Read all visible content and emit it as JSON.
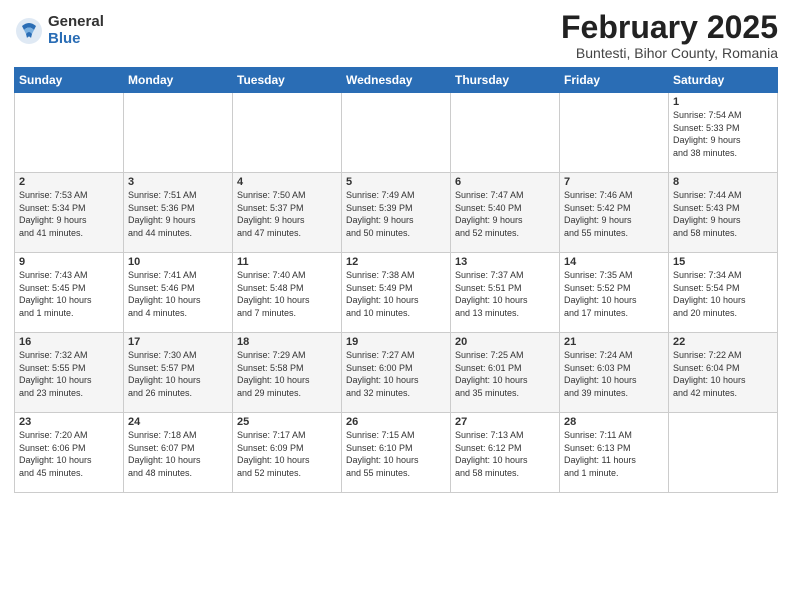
{
  "header": {
    "logo_general": "General",
    "logo_blue": "Blue",
    "month_title": "February 2025",
    "location": "Buntesti, Bihor County, Romania"
  },
  "weekdays": [
    "Sunday",
    "Monday",
    "Tuesday",
    "Wednesday",
    "Thursday",
    "Friday",
    "Saturday"
  ],
  "weeks": [
    [
      {
        "day": "",
        "info": ""
      },
      {
        "day": "",
        "info": ""
      },
      {
        "day": "",
        "info": ""
      },
      {
        "day": "",
        "info": ""
      },
      {
        "day": "",
        "info": ""
      },
      {
        "day": "",
        "info": ""
      },
      {
        "day": "1",
        "info": "Sunrise: 7:54 AM\nSunset: 5:33 PM\nDaylight: 9 hours\nand 38 minutes."
      }
    ],
    [
      {
        "day": "2",
        "info": "Sunrise: 7:53 AM\nSunset: 5:34 PM\nDaylight: 9 hours\nand 41 minutes."
      },
      {
        "day": "3",
        "info": "Sunrise: 7:51 AM\nSunset: 5:36 PM\nDaylight: 9 hours\nand 44 minutes."
      },
      {
        "day": "4",
        "info": "Sunrise: 7:50 AM\nSunset: 5:37 PM\nDaylight: 9 hours\nand 47 minutes."
      },
      {
        "day": "5",
        "info": "Sunrise: 7:49 AM\nSunset: 5:39 PM\nDaylight: 9 hours\nand 50 minutes."
      },
      {
        "day": "6",
        "info": "Sunrise: 7:47 AM\nSunset: 5:40 PM\nDaylight: 9 hours\nand 52 minutes."
      },
      {
        "day": "7",
        "info": "Sunrise: 7:46 AM\nSunset: 5:42 PM\nDaylight: 9 hours\nand 55 minutes."
      },
      {
        "day": "8",
        "info": "Sunrise: 7:44 AM\nSunset: 5:43 PM\nDaylight: 9 hours\nand 58 minutes."
      }
    ],
    [
      {
        "day": "9",
        "info": "Sunrise: 7:43 AM\nSunset: 5:45 PM\nDaylight: 10 hours\nand 1 minute."
      },
      {
        "day": "10",
        "info": "Sunrise: 7:41 AM\nSunset: 5:46 PM\nDaylight: 10 hours\nand 4 minutes."
      },
      {
        "day": "11",
        "info": "Sunrise: 7:40 AM\nSunset: 5:48 PM\nDaylight: 10 hours\nand 7 minutes."
      },
      {
        "day": "12",
        "info": "Sunrise: 7:38 AM\nSunset: 5:49 PM\nDaylight: 10 hours\nand 10 minutes."
      },
      {
        "day": "13",
        "info": "Sunrise: 7:37 AM\nSunset: 5:51 PM\nDaylight: 10 hours\nand 13 minutes."
      },
      {
        "day": "14",
        "info": "Sunrise: 7:35 AM\nSunset: 5:52 PM\nDaylight: 10 hours\nand 17 minutes."
      },
      {
        "day": "15",
        "info": "Sunrise: 7:34 AM\nSunset: 5:54 PM\nDaylight: 10 hours\nand 20 minutes."
      }
    ],
    [
      {
        "day": "16",
        "info": "Sunrise: 7:32 AM\nSunset: 5:55 PM\nDaylight: 10 hours\nand 23 minutes."
      },
      {
        "day": "17",
        "info": "Sunrise: 7:30 AM\nSunset: 5:57 PM\nDaylight: 10 hours\nand 26 minutes."
      },
      {
        "day": "18",
        "info": "Sunrise: 7:29 AM\nSunset: 5:58 PM\nDaylight: 10 hours\nand 29 minutes."
      },
      {
        "day": "19",
        "info": "Sunrise: 7:27 AM\nSunset: 6:00 PM\nDaylight: 10 hours\nand 32 minutes."
      },
      {
        "day": "20",
        "info": "Sunrise: 7:25 AM\nSunset: 6:01 PM\nDaylight: 10 hours\nand 35 minutes."
      },
      {
        "day": "21",
        "info": "Sunrise: 7:24 AM\nSunset: 6:03 PM\nDaylight: 10 hours\nand 39 minutes."
      },
      {
        "day": "22",
        "info": "Sunrise: 7:22 AM\nSunset: 6:04 PM\nDaylight: 10 hours\nand 42 minutes."
      }
    ],
    [
      {
        "day": "23",
        "info": "Sunrise: 7:20 AM\nSunset: 6:06 PM\nDaylight: 10 hours\nand 45 minutes."
      },
      {
        "day": "24",
        "info": "Sunrise: 7:18 AM\nSunset: 6:07 PM\nDaylight: 10 hours\nand 48 minutes."
      },
      {
        "day": "25",
        "info": "Sunrise: 7:17 AM\nSunset: 6:09 PM\nDaylight: 10 hours\nand 52 minutes."
      },
      {
        "day": "26",
        "info": "Sunrise: 7:15 AM\nSunset: 6:10 PM\nDaylight: 10 hours\nand 55 minutes."
      },
      {
        "day": "27",
        "info": "Sunrise: 7:13 AM\nSunset: 6:12 PM\nDaylight: 10 hours\nand 58 minutes."
      },
      {
        "day": "28",
        "info": "Sunrise: 7:11 AM\nSunset: 6:13 PM\nDaylight: 11 hours\nand 1 minute."
      },
      {
        "day": "",
        "info": ""
      }
    ]
  ]
}
